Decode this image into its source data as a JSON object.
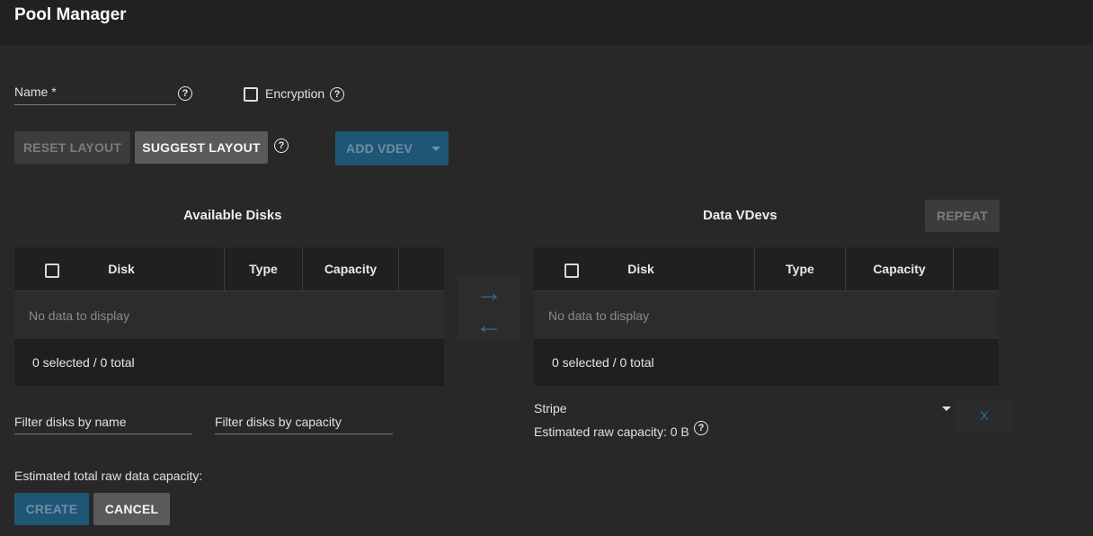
{
  "header": {
    "title": "Pool Manager"
  },
  "form": {
    "name_label": "Name *",
    "encryption_label": "Encryption"
  },
  "toolbar": {
    "reset_label": "RESET LAYOUT",
    "suggest_label": "SUGGEST LAYOUT",
    "add_vdev_label": "ADD VDEV"
  },
  "available": {
    "title": "Available Disks",
    "columns": [
      "Disk",
      "Type",
      "Capacity"
    ],
    "empty": "No data to display",
    "footer": "0 selected / 0 total",
    "filter_name": "Filter disks by name",
    "filter_capacity": "Filter disks by capacity"
  },
  "vdevs": {
    "title": "Data VDevs",
    "repeat_label": "REPEAT",
    "columns": [
      "Disk",
      "Type",
      "Capacity"
    ],
    "empty": "No data to display",
    "footer": "0 selected / 0 total",
    "layout_value": "Stripe",
    "estimated": "Estimated raw capacity: 0 B",
    "remove_label": "X"
  },
  "summary": {
    "total_label": "Estimated total raw data capacity:"
  },
  "actions": {
    "create_label": "CREATE",
    "cancel_label": "CANCEL"
  },
  "colors": {
    "accent": "#2b6f98",
    "background": "#282828"
  }
}
